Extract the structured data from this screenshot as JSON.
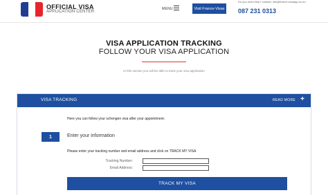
{
  "header": {
    "flag_colors": [
      "#1f3e93",
      "#ffffff",
      "#e5262c"
    ],
    "logo_title": "OFFICIAL VISA",
    "logo_subtitle": "APPLICATION CENTER",
    "menu_label": "MENU",
    "visit_button": "Visit France-Visas",
    "help_text": "Do you need help? contact: info@france.visaapp-eu.eu",
    "phone": "087 231 0313"
  },
  "hero": {
    "title": "VISA APPLICATION TRACKING",
    "subtitle": "FOLLOW YOUR VISA APPLICATION",
    "description": "In this section you will be able to track your visa application"
  },
  "panel": {
    "title": "VISA TRACKING",
    "read_more": "READ MORE",
    "intro": "Here you can follow your schengen visa after your appointment.",
    "step_number": "1",
    "step_title": "Enter your information",
    "instruction": "Please enter your tracking number and email address and click on TRACK MY VISA",
    "fields": [
      {
        "label": "Tracking Number:",
        "value": "",
        "placeholder": ""
      },
      {
        "label": "Email Address:",
        "value": "",
        "placeholder": ""
      }
    ],
    "submit_label": "TRACK MY VISA"
  },
  "colors": {
    "primary": "#1e4fa0",
    "accent_rule": "#dd3333"
  },
  "icons": {
    "menu": "hamburger-icon",
    "expand": "plus-icon"
  }
}
